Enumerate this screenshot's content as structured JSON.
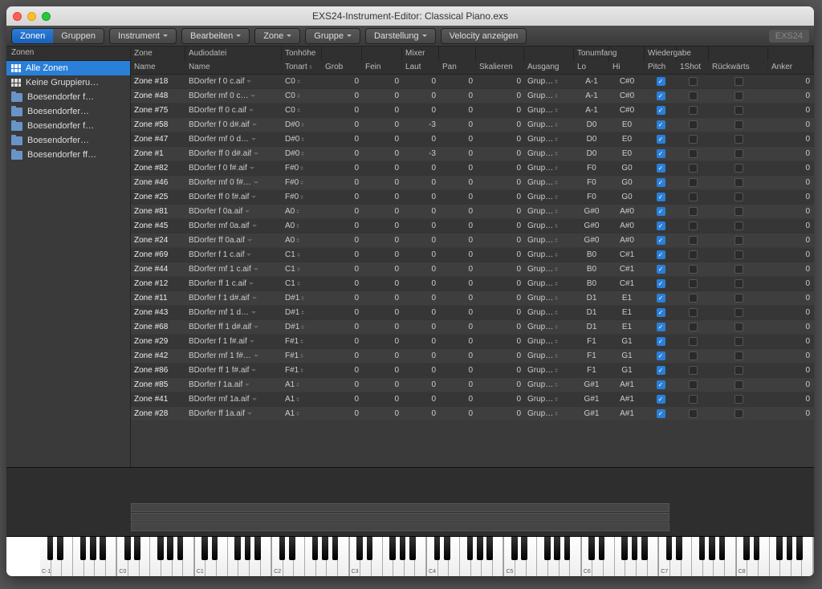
{
  "window_title": "EXS24-Instrument-Editor: Classical Piano.exs",
  "toolbar": {
    "tabs": [
      {
        "label": "Zonen",
        "selected": true
      },
      {
        "label": "Gruppen",
        "selected": false
      }
    ],
    "menus": [
      "Instrument",
      "Bearbeiten",
      "Zone",
      "Gruppe",
      "Darstellung"
    ],
    "velocity": "Velocity anzeigen",
    "badge": "EXS24"
  },
  "sidebar": {
    "title": "Zonen",
    "items": [
      {
        "icon": "grid",
        "label": "Alle Zonen",
        "selected": true
      },
      {
        "icon": "grid",
        "label": "Keine Gruppieru…",
        "selected": false
      },
      {
        "icon": "folder",
        "label": "Boesendorfer  f…",
        "selected": false
      },
      {
        "icon": "folder",
        "label": "Boesendorfer…",
        "selected": false
      },
      {
        "icon": "folder",
        "label": "Boesendorfer  f…",
        "selected": false
      },
      {
        "icon": "folder",
        "label": "Boesendorfer…",
        "selected": false
      },
      {
        "icon": "folder",
        "label": "Boesendorfer  ff…",
        "selected": false
      }
    ]
  },
  "table": {
    "groups": [
      "Zone",
      "Audiodatei",
      "Tonhöhe",
      "",
      "",
      "Mixer",
      "",
      "",
      "",
      "Tonumfang",
      "",
      "Wiedergabe",
      "",
      "",
      ""
    ],
    "cols": [
      "Name",
      "Name",
      "Tonart",
      "Grob",
      "Fein",
      "Laut",
      "Pan",
      "Skalieren",
      "Ausgang",
      "Lo",
      "Hi",
      "Pitch",
      "1Shot",
      "Rückwärts",
      "Anker"
    ],
    "rows": [
      {
        "zone": "Zone #18",
        "file": "BDorfer f  0 c.aif",
        "key": "C0",
        "grob": 0,
        "fein": 0,
        "laut": 0,
        "pan": 0,
        "skal": 0,
        "aus": "Grup…",
        "lo": "A-1",
        "hi": "C#0",
        "pitch": true,
        "anker": 0
      },
      {
        "zone": "Zone #48",
        "file": "BDorfer mf  0 c…",
        "key": "C0",
        "grob": 0,
        "fein": 0,
        "laut": 0,
        "pan": 0,
        "skal": 0,
        "aus": "Grup…",
        "lo": "A-1",
        "hi": "C#0",
        "pitch": true,
        "anker": 0
      },
      {
        "zone": "Zone #75",
        "file": "BDorfer ff  0 c.aif",
        "key": "C0",
        "grob": 0,
        "fein": 0,
        "laut": 0,
        "pan": 0,
        "skal": 0,
        "aus": "Grup…",
        "lo": "A-1",
        "hi": "C#0",
        "pitch": true,
        "anker": 0
      },
      {
        "zone": "Zone #58",
        "file": "BDorfer f  0 d#.aif",
        "key": "D#0",
        "grob": 0,
        "fein": 0,
        "laut": -3,
        "pan": 0,
        "skal": 0,
        "aus": "Grup…",
        "lo": "D0",
        "hi": "E0",
        "pitch": true,
        "anker": 0
      },
      {
        "zone": "Zone #47",
        "file": "BDorfer mf  0 d…",
        "key": "D#0",
        "grob": 0,
        "fein": 0,
        "laut": 0,
        "pan": 0,
        "skal": 0,
        "aus": "Grup…",
        "lo": "D0",
        "hi": "E0",
        "pitch": true,
        "anker": 0
      },
      {
        "zone": "Zone #1",
        "file": "BDorfer ff  0 d#.aif",
        "key": "D#0",
        "grob": 0,
        "fein": 0,
        "laut": -3,
        "pan": 0,
        "skal": 0,
        "aus": "Grup…",
        "lo": "D0",
        "hi": "E0",
        "pitch": true,
        "anker": 0
      },
      {
        "zone": "Zone #82",
        "file": "BDorfer f  0 f#.aif",
        "key": "F#0",
        "grob": 0,
        "fein": 0,
        "laut": 0,
        "pan": 0,
        "skal": 0,
        "aus": "Grup…",
        "lo": "F0",
        "hi": "G0",
        "pitch": true,
        "anker": 0
      },
      {
        "zone": "Zone #46",
        "file": "BDorfer mf  0 f#…",
        "key": "F#0",
        "grob": 0,
        "fein": 0,
        "laut": 0,
        "pan": 0,
        "skal": 0,
        "aus": "Grup…",
        "lo": "F0",
        "hi": "G0",
        "pitch": true,
        "anker": 0
      },
      {
        "zone": "Zone #25",
        "file": "BDorfer ff  0 f#.aif",
        "key": "F#0",
        "grob": 0,
        "fein": 0,
        "laut": 0,
        "pan": 0,
        "skal": 0,
        "aus": "Grup…",
        "lo": "F0",
        "hi": "G0",
        "pitch": true,
        "anker": 0
      },
      {
        "zone": "Zone #81",
        "file": "BDorfer f  0a.aif",
        "key": "A0",
        "grob": 0,
        "fein": 0,
        "laut": 0,
        "pan": 0,
        "skal": 0,
        "aus": "Grup…",
        "lo": "G#0",
        "hi": "A#0",
        "pitch": true,
        "anker": 0
      },
      {
        "zone": "Zone #45",
        "file": "BDorfer mf  0a.aif",
        "key": "A0",
        "grob": 0,
        "fein": 0,
        "laut": 0,
        "pan": 0,
        "skal": 0,
        "aus": "Grup…",
        "lo": "G#0",
        "hi": "A#0",
        "pitch": true,
        "anker": 0
      },
      {
        "zone": "Zone #24",
        "file": "BDorfer ff  0a.aif",
        "key": "A0",
        "grob": 0,
        "fein": 0,
        "laut": 0,
        "pan": 0,
        "skal": 0,
        "aus": "Grup…",
        "lo": "G#0",
        "hi": "A#0",
        "pitch": true,
        "anker": 0
      },
      {
        "zone": "Zone #69",
        "file": "BDorfer f  1 c.aif",
        "key": "C1",
        "grob": 0,
        "fein": 0,
        "laut": 0,
        "pan": 0,
        "skal": 0,
        "aus": "Grup…",
        "lo": "B0",
        "hi": "C#1",
        "pitch": true,
        "anker": 0
      },
      {
        "zone": "Zone #44",
        "file": "BDorfer mf  1 c.aif",
        "key": "C1",
        "grob": 0,
        "fein": 0,
        "laut": 0,
        "pan": 0,
        "skal": 0,
        "aus": "Grup…",
        "lo": "B0",
        "hi": "C#1",
        "pitch": true,
        "anker": 0
      },
      {
        "zone": "Zone #12",
        "file": "BDorfer ff  1 c.aif",
        "key": "C1",
        "grob": 0,
        "fein": 0,
        "laut": 0,
        "pan": 0,
        "skal": 0,
        "aus": "Grup…",
        "lo": "B0",
        "hi": "C#1",
        "pitch": true,
        "anker": 0
      },
      {
        "zone": "Zone #11",
        "file": "BDorfer f  1 d#.aif",
        "key": "D#1",
        "grob": 0,
        "fein": 0,
        "laut": 0,
        "pan": 0,
        "skal": 0,
        "aus": "Grup…",
        "lo": "D1",
        "hi": "E1",
        "pitch": true,
        "anker": 0
      },
      {
        "zone": "Zone #43",
        "file": "BDorfer mf  1 d…",
        "key": "D#1",
        "grob": 0,
        "fein": 0,
        "laut": 0,
        "pan": 0,
        "skal": 0,
        "aus": "Grup…",
        "lo": "D1",
        "hi": "E1",
        "pitch": true,
        "anker": 0
      },
      {
        "zone": "Zone #68",
        "file": "BDorfer ff  1 d#.aif",
        "key": "D#1",
        "grob": 0,
        "fein": 0,
        "laut": 0,
        "pan": 0,
        "skal": 0,
        "aus": "Grup…",
        "lo": "D1",
        "hi": "E1",
        "pitch": true,
        "anker": 0
      },
      {
        "zone": "Zone #29",
        "file": "BDorfer f  1 f#.aif",
        "key": "F#1",
        "grob": 0,
        "fein": 0,
        "laut": 0,
        "pan": 0,
        "skal": 0,
        "aus": "Grup…",
        "lo": "F1",
        "hi": "G1",
        "pitch": true,
        "anker": 0
      },
      {
        "zone": "Zone #42",
        "file": "BDorfer mf  1 f#…",
        "key": "F#1",
        "grob": 0,
        "fein": 0,
        "laut": 0,
        "pan": 0,
        "skal": 0,
        "aus": "Grup…",
        "lo": "F1",
        "hi": "G1",
        "pitch": true,
        "anker": 0
      },
      {
        "zone": "Zone #86",
        "file": "BDorfer ff  1 f#.aif",
        "key": "F#1",
        "grob": 0,
        "fein": 0,
        "laut": 0,
        "pan": 0,
        "skal": 0,
        "aus": "Grup…",
        "lo": "F1",
        "hi": "G1",
        "pitch": true,
        "anker": 0
      },
      {
        "zone": "Zone #85",
        "file": "BDorfer f  1a.aif",
        "key": "A1",
        "grob": 0,
        "fein": 0,
        "laut": 0,
        "pan": 0,
        "skal": 0,
        "aus": "Grup…",
        "lo": "G#1",
        "hi": "A#1",
        "pitch": true,
        "anker": 0
      },
      {
        "zone": "Zone #41",
        "file": "BDorfer mf  1a.aif",
        "key": "A1",
        "grob": 0,
        "fein": 0,
        "laut": 0,
        "pan": 0,
        "skal": 0,
        "aus": "Grup…",
        "lo": "G#1",
        "hi": "A#1",
        "pitch": true,
        "anker": 0
      },
      {
        "zone": "Zone #28",
        "file": "BDorfer ff  1a.aif",
        "key": "A1",
        "grob": 0,
        "fein": 0,
        "laut": 0,
        "pan": 0,
        "skal": 0,
        "aus": "Grup…",
        "lo": "G#1",
        "hi": "A#1",
        "pitch": true,
        "anker": 0
      }
    ]
  },
  "octaves": [
    "C-1",
    "C0",
    "C1",
    "C2",
    "C3",
    "C4",
    "C5",
    "C6",
    "C7",
    "C8"
  ]
}
